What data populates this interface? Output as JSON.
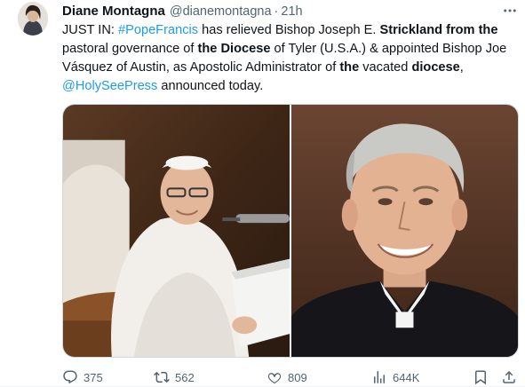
{
  "tweet": {
    "author_name": "Diane Montagna",
    "handle": "@dianemontagna",
    "separator": "·",
    "time": "21h",
    "text": {
      "s1": "JUST IN: ",
      "link1": "#PopeFrancis",
      "s2": " has relieved Bishop Joseph E. ",
      "b1": "Strickland from the",
      "s3": " pastoral governance of ",
      "b2": "the Diocese",
      "s4": " of Tyler (U.S.A.) & appointed Bishop Joe Vásquez of Austin, as Apostolic Administrator of ",
      "b3": "the",
      "s5": " vacated ",
      "b4": "diocese",
      "s6": ", ",
      "link2": "@HolySeePress",
      "s7": " announced today."
    },
    "media": [
      "pope-photo",
      "bishop-photo"
    ],
    "metrics": {
      "replies": "375",
      "retweets": "562",
      "likes": "809",
      "views": "644K"
    }
  },
  "icons": {
    "reply": "reply-icon",
    "retweet": "retweet-icon",
    "like": "heart-icon",
    "views": "views-chart-icon",
    "bookmark": "bookmark-icon",
    "share": "share-icon",
    "more": "more-dots-icon"
  },
  "colors": {
    "link": "#1d9bf0",
    "secondary_text": "#536471",
    "primary_text": "#0f1419"
  }
}
